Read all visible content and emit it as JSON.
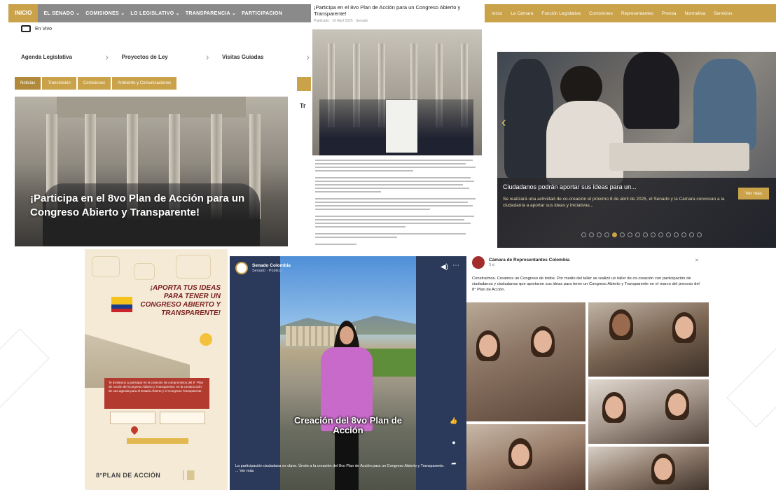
{
  "panel1": {
    "nav": [
      "INICIO",
      "EL SENADO ⌄",
      "COMISIONES ⌄",
      "LO LEGISLATIVO ⌄",
      "TRANSPARENCIA ⌄",
      "PARTICIPACION"
    ],
    "envivo": "En Vivo",
    "quick_links": [
      "Agenda Legislativa",
      "Proyectos de Ley",
      "Visitas Guiadas"
    ],
    "tabs": [
      "Noticias",
      "Transmisión",
      "Comisiones",
      "Ambiente y Comunicaciones"
    ],
    "headline": "¡Participa en el 8vo Plan de Acción para un Congreso Abierto y Transparente!",
    "side_letter": "Tr"
  },
  "panel2": {
    "title": "¡Participa en el 8vo Plan de Acción para un Congreso Abierto y Transparente!",
    "meta": "Publicado · 10 Abril 2025 · Senado"
  },
  "panel3": {
    "nav": [
      "Inicio",
      "La Cámara",
      "Función Legislativa",
      "Comisiones",
      "Representantes",
      "Prensa",
      "Normativa",
      "Servicios"
    ],
    "caption_title": "Ciudadanos podrán aportar sus ideas para un...",
    "caption_text": "Se realizará una actividad de co-creación el próximo 8 de abril de 2025, el Senado y la Cámara convocan a la ciudadanía a aportar sus ideas y iniciativas...",
    "button": "Ver más"
  },
  "panel4": {
    "heading": "¡APORTA TUS IDEAS PARA TENER UN CONGRESO ABIERTO Y TRANSPARENTE!",
    "red_box": "Te invitamos a participar en la creación de compromisos del 8° Plan de Acción del Congreso Abierto y Transparente, en la construcción de una agenda para el Estado Abierto y el Congreso Transparente.",
    "footer": "8°PLAN DE ACCIÓN"
  },
  "panel5": {
    "channel": "Senado Colombia",
    "sub": "Senado · Público",
    "overlay": "Creación del 8vo Plan de Acción",
    "description": "La participación ciudadana es clave. Únete a la creación del 8vo Plan de Acción para un Congreso Abierto y Transparente. ... Ver más",
    "icons": [
      "like-icon",
      "comment-icon",
      "share-icon"
    ]
  },
  "panel6": {
    "page_name": "Cámara de Representantes Colombia",
    "time": "3 d",
    "text": "Construimos. Creamos un Congreso de todos. Por medio del taller se realizó un taller de co-creación con participación de ciudadanos y ciudadanas que aportaron sus ideas para tener un Congreso Abierto y Transparente en el marco del proceso del 8° Plan de Acción."
  }
}
